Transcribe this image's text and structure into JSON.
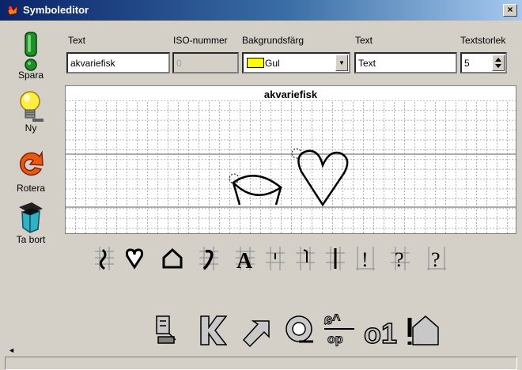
{
  "window": {
    "title": "Symboleditor",
    "close_glyph": "×"
  },
  "sidebar": {
    "buttons": [
      {
        "label": "Spara",
        "icon": "exclamation-icon",
        "color": "#1e8f2a"
      },
      {
        "label": "Ny",
        "icon": "lightbulb-icon",
        "color": "#ffee44"
      },
      {
        "label": "Rotera",
        "icon": "rotate-arrow-icon",
        "color": "#e85a10"
      },
      {
        "label": "Ta bort",
        "icon": "trash-bin-icon",
        "color": "#2fb2c8"
      }
    ]
  },
  "form": {
    "text_label": "Text",
    "text_value": "akvariefisk",
    "iso_label": "ISO-nummer",
    "iso_value": "0",
    "bg_label": "Bakgrundsfärg",
    "bg_value": "Gul",
    "bg_color": "#ffff00",
    "text2_label": "Text",
    "text2_value": "Text",
    "size_label": "Textstorlek",
    "size_value": "5"
  },
  "canvas": {
    "title": "akvariefisk"
  },
  "palette": {
    "shapes": [
      "wave-shape",
      "heart-shape",
      "house-shape",
      "hook-shape",
      "letter-a-shape",
      "cross-tick-shape",
      "cross-dot-shape",
      "plus-bar-shape",
      "bar-shape",
      "question-box-shape",
      "question-shape"
    ],
    "letter_a": "A",
    "question": "?",
    "bar": "!"
  },
  "toolbar": {
    "tools": [
      "align-bottom-tool",
      "mirror-k-tool",
      "diagonal-arrow-tool",
      "circle-tool",
      "flip-top-bottom-tool",
      "o1-tool",
      "house-exclaim-tool"
    ],
    "flip_top": "ɕ^",
    "flip_bottom": "op",
    "o1_label": "o1"
  },
  "statusbar": {
    "text": ""
  }
}
